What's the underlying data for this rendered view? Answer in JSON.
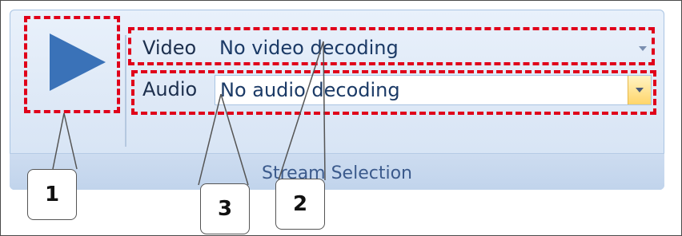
{
  "play_button": {
    "icon": "play-icon",
    "color": "#3a72b8"
  },
  "video": {
    "label": "Video",
    "value": "No video decoding"
  },
  "audio": {
    "label": "Audio",
    "value": "No audio decoding"
  },
  "group": {
    "label": "Stream Selection"
  },
  "callouts": {
    "one": "1",
    "two": "2",
    "three": "3"
  },
  "highlight_color": "#e0001a"
}
